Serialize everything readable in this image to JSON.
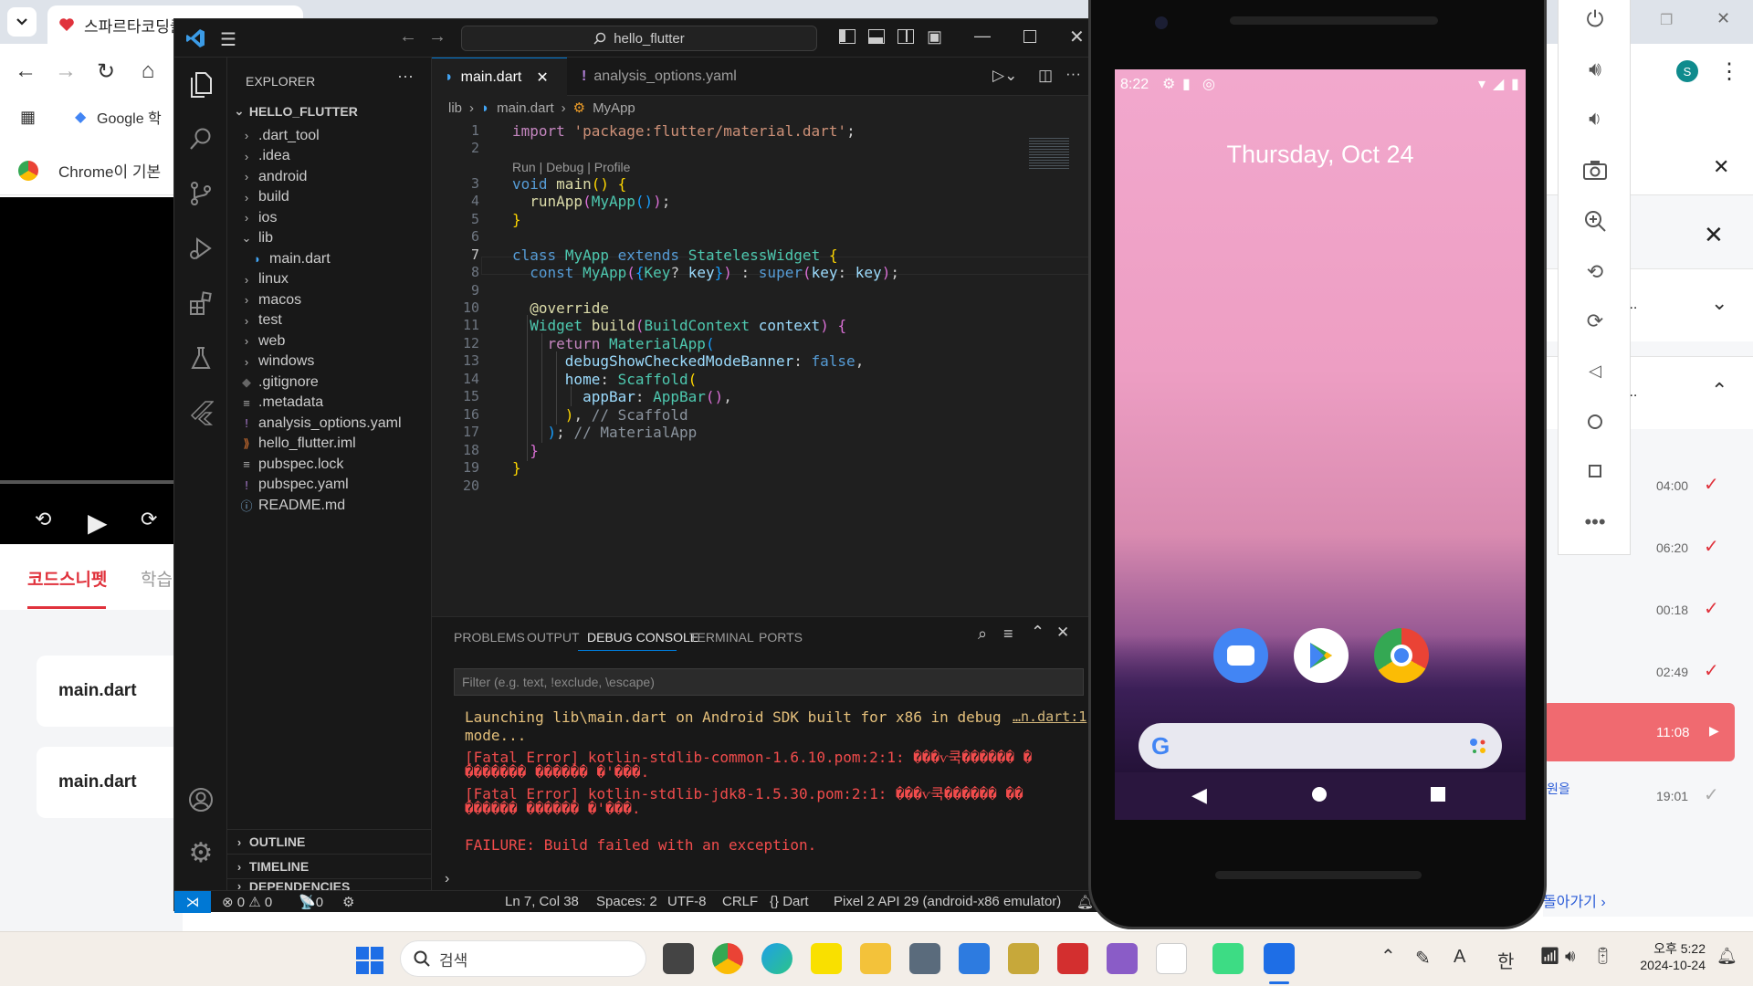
{
  "browser": {
    "tab_title": "스파르타코딩클",
    "bookmark_google": "Google 학",
    "info_text": "Chrome이 기본",
    "avatar_letter": "S",
    "snippet_tab": "코드스니펫",
    "study_tab": "학습",
    "cards": [
      "main.dart",
      "main.dart"
    ],
    "right_items": [
      {
        "text": "...",
        "time": ""
      },
      {
        "text": "...",
        "time": ""
      }
    ],
    "playlist_times": [
      "04:00",
      "06:20",
      "00:18",
      "02:49",
      "11:08",
      "19:01"
    ],
    "active_time": "11:08",
    "back_link": "돌아가기",
    "partial_text": "원을"
  },
  "vscode": {
    "search_text": "hello_flutter",
    "explorer_title": "EXPLORER",
    "project_name": "HELLO_FLUTTER",
    "tree": [
      {
        "name": ".dart_tool",
        "type": "folder",
        "level": 1,
        "open": false
      },
      {
        "name": ".idea",
        "type": "folder",
        "level": 1,
        "open": false
      },
      {
        "name": "android",
        "type": "folder",
        "level": 1,
        "open": false
      },
      {
        "name": "build",
        "type": "folder",
        "level": 1,
        "open": false
      },
      {
        "name": "ios",
        "type": "folder",
        "level": 1,
        "open": false
      },
      {
        "name": "lib",
        "type": "folder",
        "level": 1,
        "open": true
      },
      {
        "name": "main.dart",
        "type": "dart",
        "level": 2
      },
      {
        "name": "linux",
        "type": "folder",
        "level": 1,
        "open": false
      },
      {
        "name": "macos",
        "type": "folder",
        "level": 1,
        "open": false
      },
      {
        "name": "test",
        "type": "folder",
        "level": 1,
        "open": false
      },
      {
        "name": "web",
        "type": "folder",
        "level": 1,
        "open": false
      },
      {
        "name": "windows",
        "type": "folder",
        "level": 1,
        "open": false
      },
      {
        "name": ".gitignore",
        "type": "git",
        "level": 1
      },
      {
        "name": ".metadata",
        "type": "file",
        "level": 1
      },
      {
        "name": "analysis_options.yaml",
        "type": "yaml",
        "level": 1
      },
      {
        "name": "hello_flutter.iml",
        "type": "rss",
        "level": 1
      },
      {
        "name": "pubspec.lock",
        "type": "file",
        "level": 1
      },
      {
        "name": "pubspec.yaml",
        "type": "yaml",
        "level": 1
      },
      {
        "name": "README.md",
        "type": "info",
        "level": 1
      }
    ],
    "sections": [
      "OUTLINE",
      "TIMELINE",
      "DEPENDENCIES"
    ],
    "tabs": [
      "main.dart",
      "analysis_options.yaml"
    ],
    "breadcrumb": [
      "lib",
      "main.dart",
      "MyApp"
    ],
    "codelens": "Run | Debug | Profile",
    "line_numbers": [
      "1",
      "2",
      "3",
      "4",
      "5",
      "6",
      "7",
      "8",
      "9",
      "10",
      "11",
      "12",
      "13",
      "14",
      "15",
      "16",
      "17",
      "18",
      "19",
      "20"
    ],
    "code": {
      "l1_kw": "import",
      "l1_str": "'package:flutter/material.dart'",
      "l1_end": ";",
      "l3_ty": "void",
      "l3_fn": "main",
      "l4_fn": "runApp",
      "l4_cls": "MyApp",
      "l7_kw": "class",
      "l7_cls": "MyApp",
      "l7_ext": "extends",
      "l7_base": "StatelessWidget",
      "l8_const": "const",
      "l8_cls": "MyApp",
      "l8_type": "Key",
      "l8_var": "key",
      "l8_super": "super",
      "l10_ann": "@override",
      "l11_ty": "Widget",
      "l11_fn": "build",
      "l11_ptype": "BuildContext",
      "l11_var": "context",
      "l12_kw": "return",
      "l12_cls": "MaterialApp",
      "l13_prop": "debugShowCheckedModeBanner",
      "l13_val": "false",
      "l14_prop": "home",
      "l14_cls": "Scaffold",
      "l15_prop": "appBar",
      "l15_cls": "AppBar",
      "l16_cm": "// Scaffold",
      "l17_cm": "// MaterialApp"
    },
    "panel_tabs": [
      "PROBLEMS",
      "OUTPUT",
      "DEBUG CONSOLE",
      "TERMINAL",
      "PORTS"
    ],
    "filter_placeholder": "Filter (e.g. text, !exclude, \\escape)",
    "console": [
      {
        "text": "Launching lib\\main.dart on Android SDK built for x86 in debug",
        "color": "#e5c07b"
      },
      {
        "text": "mode...",
        "color": "#e5c07b"
      },
      {
        "text": "[Fatal Error] kotlin-stdlib-common-1.6.10.pom:2:1: ���ѵ쿡������ �",
        "color": "#f14c4c"
      },
      {
        "text": "������� ������ �'���.",
        "color": "#f14c4c"
      },
      {
        "text": "[Fatal Error] kotlin-stdlib-jdk8-1.5.30.pom:2:1: ���ѵ쿡������ ��",
        "color": "#f14c4c"
      },
      {
        "text": "������ ������ �'���.",
        "color": "#f14c4c"
      },
      {
        "text": "FAILURE: Build failed with an exception.",
        "color": "#f14c4c"
      }
    ],
    "console_link": "…n.dart:1",
    "status": {
      "errors": "0",
      "warnings": "0",
      "ports": "0",
      "position": "Ln 7, Col 38",
      "spaces": "Spaces: 2",
      "encoding": "UTF-8",
      "eol": "CRLF",
      "language": "Dart",
      "device": "Pixel 2 API 29 (android-x86 emulator)"
    }
  },
  "phone": {
    "time": "8:22",
    "date": "Thursday, Oct 24"
  },
  "taskbar": {
    "search_label": "검색",
    "clock_time": "오후 5:22",
    "clock_date": "2024-10-24",
    "ime_a": "A",
    "ime_han": "한"
  }
}
